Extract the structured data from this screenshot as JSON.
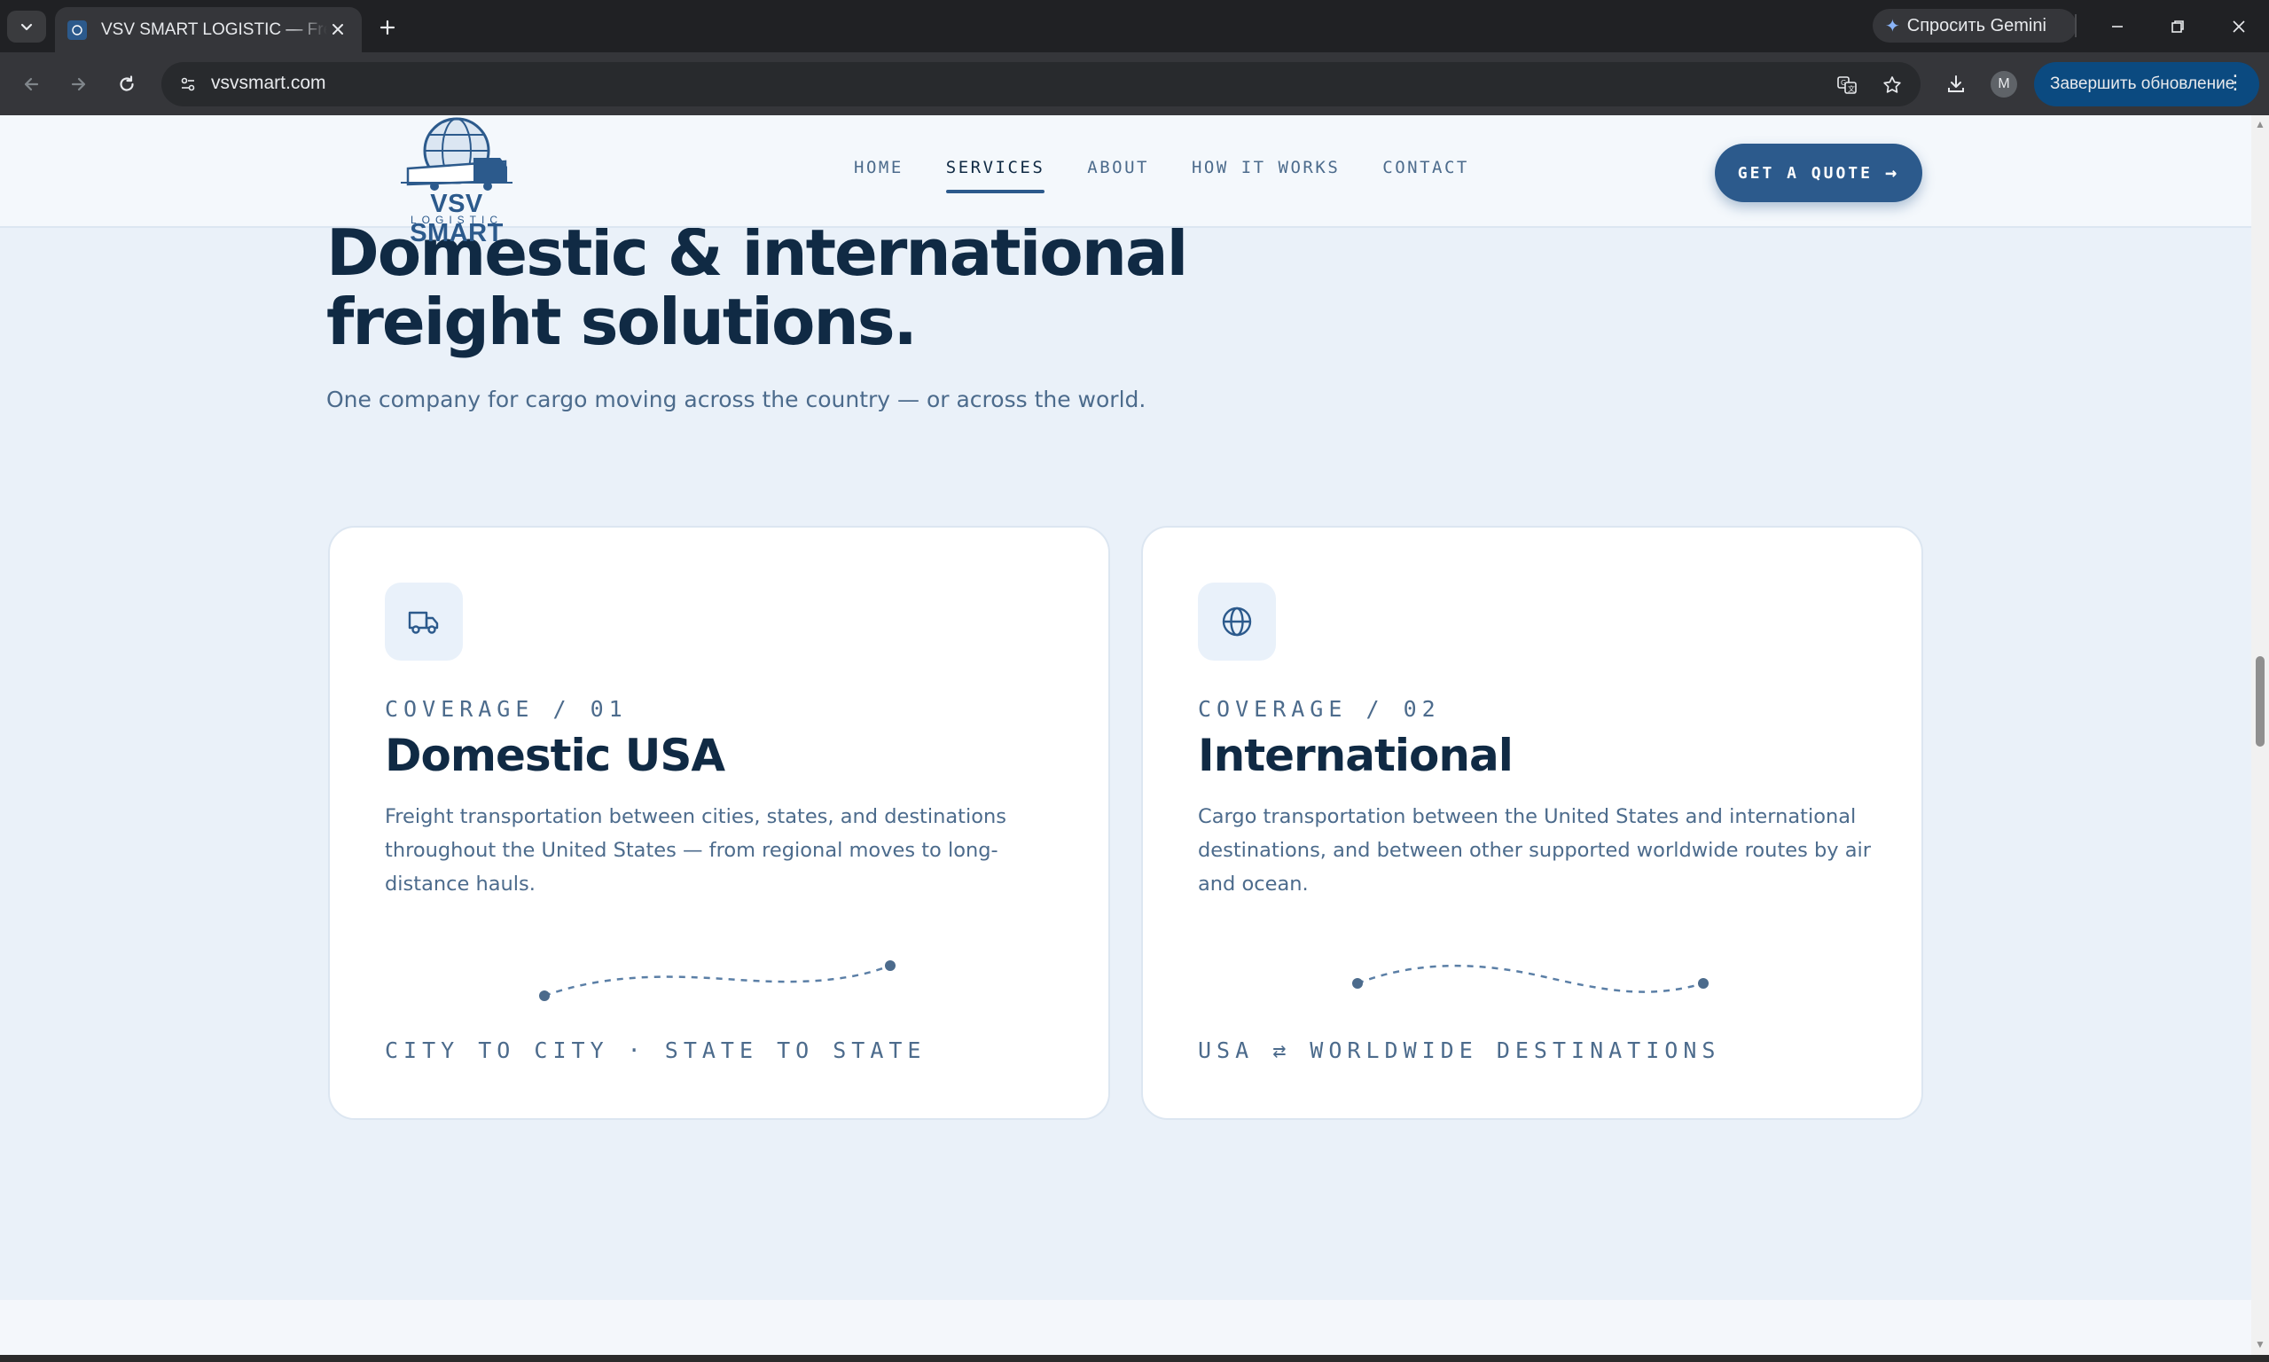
{
  "browser": {
    "tab_title": "VSV SMART LOGISTIC — Freight",
    "url": "vsvsmart.com",
    "gemini_label": "Спросить Gemini",
    "profile_initial": "M",
    "update_label": "Завершить обновление"
  },
  "header": {
    "logo_text": "VSV SMART",
    "logo_sub": "LOGISTIC",
    "nav": [
      {
        "label": "HOME"
      },
      {
        "label": "SERVICES"
      },
      {
        "label": "ABOUT"
      },
      {
        "label": "HOW IT WORKS"
      },
      {
        "label": "CONTACT"
      }
    ],
    "active_nav": "SERVICES",
    "cta_label": "GET A QUOTE"
  },
  "hero": {
    "title_line1": "Domestic & international",
    "title_line2": "freight solutions.",
    "subtitle": "One company for cargo moving across the country — or across the world."
  },
  "cards": [
    {
      "kicker": "COVERAGE / 01",
      "title": "Domestic USA",
      "description": "Freight transportation between cities, states, and destinations throughout the United States — from regional moves to long-distance hauls.",
      "footer": "CITY TO CITY · STATE TO STATE",
      "icon": "truck-icon"
    },
    {
      "kicker": "COVERAGE / 02",
      "title": "International",
      "description": "Cargo transportation between the United States and international destinations, and between other supported worldwide routes by air and ocean.",
      "footer": "USA ⇄ WORLDWIDE DESTINATIONS",
      "icon": "globe-icon"
    }
  ],
  "colors": {
    "brand": "#2c5a8c",
    "heading": "#102a44",
    "body_text": "#4c6b8c",
    "page_bg": "#eaf1f9"
  }
}
